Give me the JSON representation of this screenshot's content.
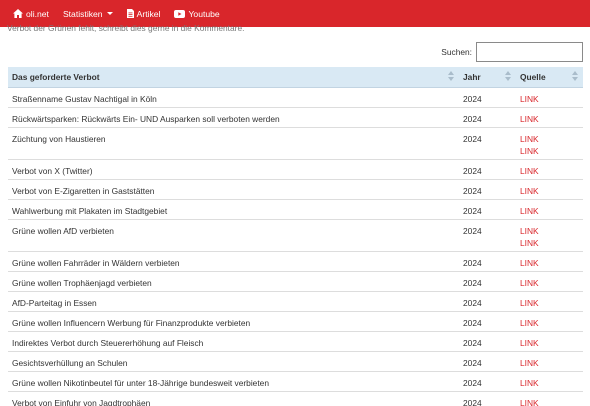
{
  "nav": {
    "brand": "oli.net",
    "stats": "Statistiken",
    "articles": "Artikel",
    "youtube": "Youtube"
  },
  "intro_text": "Verbot der Grünen fehlt, schreibt dies gerne in die Kommentare.",
  "search": {
    "label": "Suchen:",
    "value": ""
  },
  "table": {
    "headers": [
      "Das geforderte Verbot",
      "Jahr",
      "Quelle"
    ],
    "rows": [
      {
        "title": "Straßenname Gustav Nachtigal in Köln",
        "year": "2024",
        "links": [
          "LINK"
        ]
      },
      {
        "title": "Rückwärtsparken: Rückwärts Ein- UND Ausparken soll verboten werden",
        "year": "2024",
        "links": [
          "LINK"
        ]
      },
      {
        "title": "Züchtung von Haustieren",
        "year": "2024",
        "links": [
          "LINK",
          "LINK"
        ]
      },
      {
        "title": "Verbot von X (Twitter)",
        "year": "2024",
        "links": [
          "LINK"
        ]
      },
      {
        "title": "Verbot von E-Zigaretten in Gaststätten",
        "year": "2024",
        "links": [
          "LINK"
        ]
      },
      {
        "title": "Wahlwerbung mit Plakaten im Stadtgebiet",
        "year": "2024",
        "links": [
          "LINK"
        ]
      },
      {
        "title": "Grüne wollen AfD verbieten",
        "year": "2024",
        "links": [
          "LINK",
          "LINK"
        ]
      },
      {
        "title": "Grüne wollen Fahrräder in Wäldern verbieten",
        "year": "2024",
        "links": [
          "LINK"
        ]
      },
      {
        "title": "Grüne wollen Trophäenjagd verbieten",
        "year": "2024",
        "links": [
          "LINK"
        ]
      },
      {
        "title": "AfD-Parteitag in Essen",
        "year": "2024",
        "links": [
          "LINK"
        ]
      },
      {
        "title": "Grüne wollen Influencern Werbung für Finanzprodukte verbieten",
        "year": "2024",
        "links": [
          "LINK"
        ]
      },
      {
        "title": "Indirektes Verbot durch Steuererhöhung auf Fleisch",
        "year": "2024",
        "links": [
          "LINK"
        ]
      },
      {
        "title": "Gesichtsverhüllung an Schulen",
        "year": "2024",
        "links": [
          "LINK"
        ]
      },
      {
        "title": "Grüne wollen Nikotinbeutel für unter 18-Jährige bundesweit verbieten",
        "year": "2024",
        "links": [
          "LINK"
        ]
      },
      {
        "title": "Verbot von Einfuhr von Jagdtrophäen",
        "year": "2024",
        "links": [
          "LINK"
        ]
      }
    ]
  },
  "colors": {
    "navbar": "#d9262b",
    "header_row": "#d9e9f4",
    "link": "#d9262b"
  },
  "icons": {
    "brand": "home-icon",
    "articles": "document-icon",
    "youtube": "youtube-icon"
  }
}
